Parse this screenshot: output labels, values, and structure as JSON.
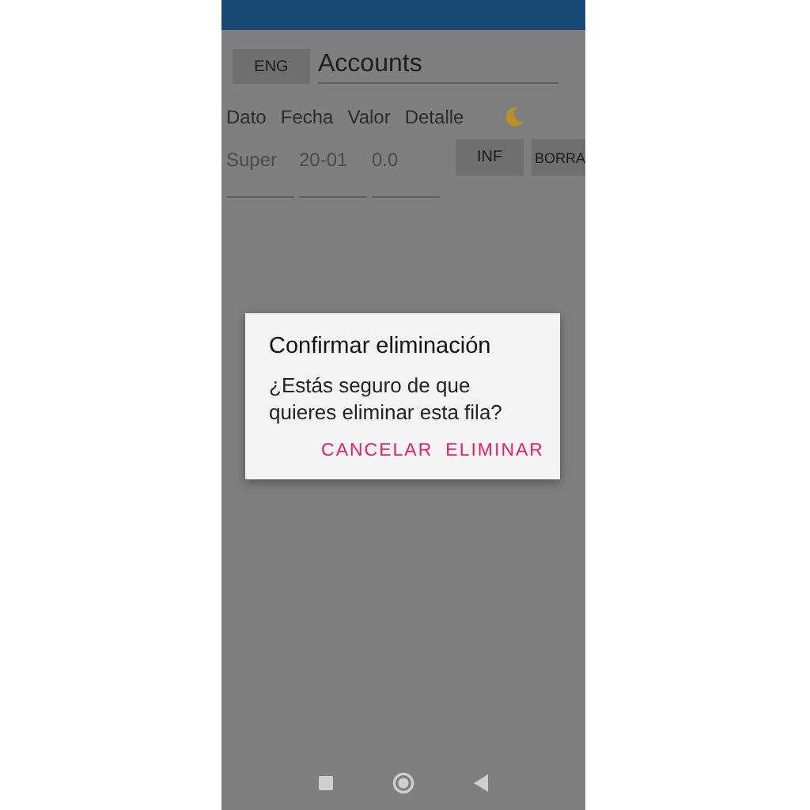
{
  "top_bar": {
    "language_button": "ENG",
    "title_field": {
      "value": "Accounts"
    }
  },
  "columns": [
    "Dato",
    "Fecha",
    "Valor",
    "Detalle"
  ],
  "entry_row": {
    "fields": [
      {
        "placeholder": "Super"
      },
      {
        "placeholder": "20-01"
      },
      {
        "placeholder": "0.0"
      }
    ],
    "buttons": [
      "INF",
      "BORRA"
    ]
  },
  "dialog": {
    "title": "Confirmar eliminación",
    "message": "¿Estás seguro de que quieres eliminar esta fila?",
    "buttons": [
      "CANCELAR",
      "ELIMINAR"
    ]
  }
}
